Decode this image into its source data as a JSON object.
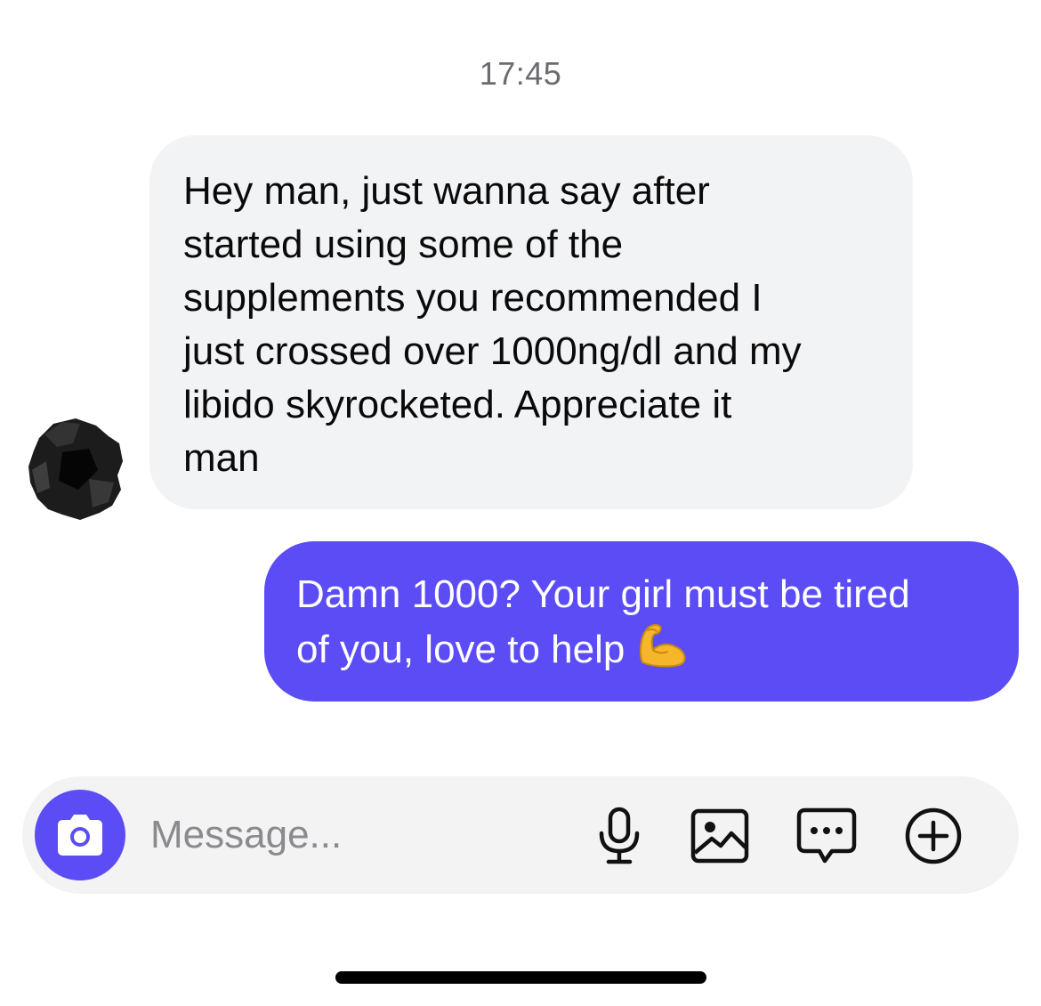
{
  "conversation": {
    "timestamp": "17:45",
    "messages": [
      {
        "direction": "incoming",
        "lines": [
          "Hey man, just wanna say after",
          "started using some of the",
          "supplements you recommended I",
          "just crossed over 1000ng/dl and my",
          "libido skyrocketed. Appreciate it",
          "man"
        ]
      },
      {
        "direction": "outgoing",
        "lines": [
          "Damn 1000? Your girl must be tired",
          "of you, love to help"
        ],
        "emoji": "flexed-biceps-icon"
      }
    ]
  },
  "composer": {
    "placeholder": "Message...",
    "camera_icon": "camera-icon",
    "icons": [
      "microphone-icon",
      "image-icon",
      "sticker-chat-icon",
      "add-icon"
    ]
  },
  "colors": {
    "accent": "#5b4cf5",
    "incoming_bubble": "#f2f3f5",
    "timestamp_text": "#6b6b70",
    "placeholder_text": "#8a8a8f"
  }
}
